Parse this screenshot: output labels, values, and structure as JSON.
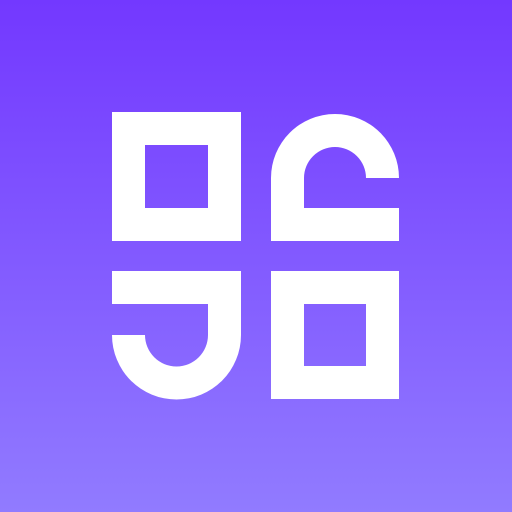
{
  "icon": {
    "name": "app-logo-icon",
    "background_top_color": "#7338FF",
    "background_bottom_color": "#917BFF",
    "foreground_color": "#FFFFFF"
  }
}
